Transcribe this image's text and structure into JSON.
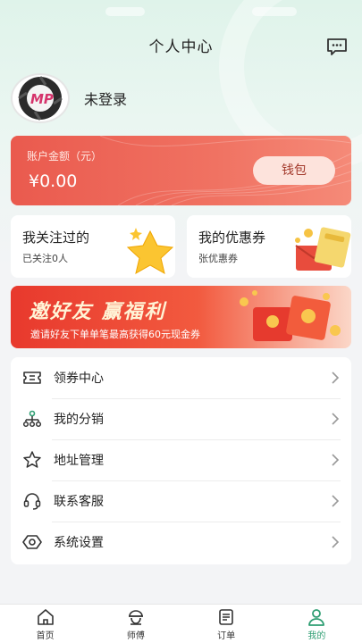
{
  "header": {
    "title": "个人中心"
  },
  "profile": {
    "login_status": "未登录",
    "logo_text": "MP"
  },
  "wallet": {
    "label": "账户金额（元）",
    "amount": "¥0.00",
    "button_label": "钱包"
  },
  "follow_card": {
    "title": "我关注过的",
    "subtitle": "已关注0人"
  },
  "coupon_card": {
    "title": "我的优惠券",
    "subtitle": "张优惠券"
  },
  "banner": {
    "title": "邀好友 赢福利",
    "subtitle": "邀请好友下单单笔最高获得60元现金券"
  },
  "menu": [
    {
      "label": "领券中心",
      "icon": "ticket-icon"
    },
    {
      "label": "我的分销",
      "icon": "distribution-icon"
    },
    {
      "label": "地址管理",
      "icon": "star-icon"
    },
    {
      "label": "联系客服",
      "icon": "headset-icon"
    },
    {
      "label": "系统设置",
      "icon": "settings-icon"
    }
  ],
  "tabbar": [
    {
      "label": "首页",
      "icon": "home-icon"
    },
    {
      "label": "师傅",
      "icon": "worker-icon"
    },
    {
      "label": "订单",
      "icon": "order-icon"
    },
    {
      "label": "我的",
      "icon": "user-icon",
      "active": true
    }
  ],
  "colors": {
    "accent": "#2f9e73",
    "wallet": "#ea5a4e",
    "banner": "#e8392d"
  }
}
